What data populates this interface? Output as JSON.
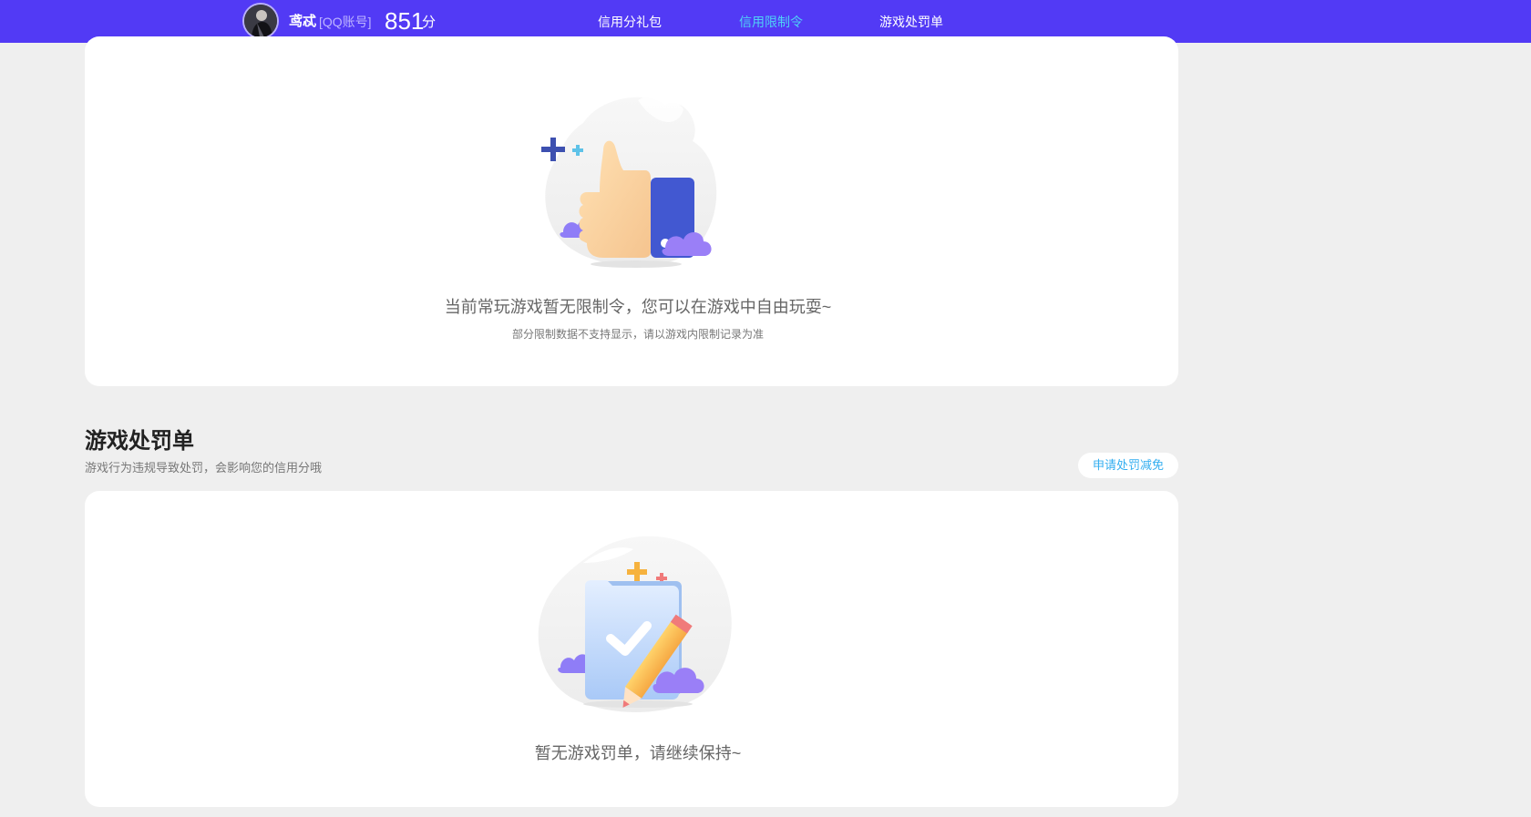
{
  "header": {
    "username": "鸢忒",
    "account_type": "[QQ账号]",
    "score": "851",
    "score_unit": "分",
    "tabs": [
      {
        "label": "信用分礼包",
        "active": false
      },
      {
        "label": "信用限制令",
        "active": true
      },
      {
        "label": "游戏处罚单",
        "active": false
      }
    ],
    "accent_color": "#523af5",
    "active_tab_color": "#4fd1f5"
  },
  "restriction_section": {
    "illustration_icon": "thumbs-up-illustration",
    "empty_message": "当前常玩游戏暂无限制令，您可以在游戏中自由玩耍~",
    "note": "部分限制数据不支持显示，请以游戏内限制记录为准"
  },
  "penalty_section": {
    "title": "游戏处罚单",
    "subtitle": "游戏行为违规导致处罚，会影响您的信用分哦",
    "appeal_button": "申请处罚减免",
    "illustration_icon": "checklist-pencil-illustration",
    "empty_message": "暂无游戏罚单，请继续保持~"
  }
}
